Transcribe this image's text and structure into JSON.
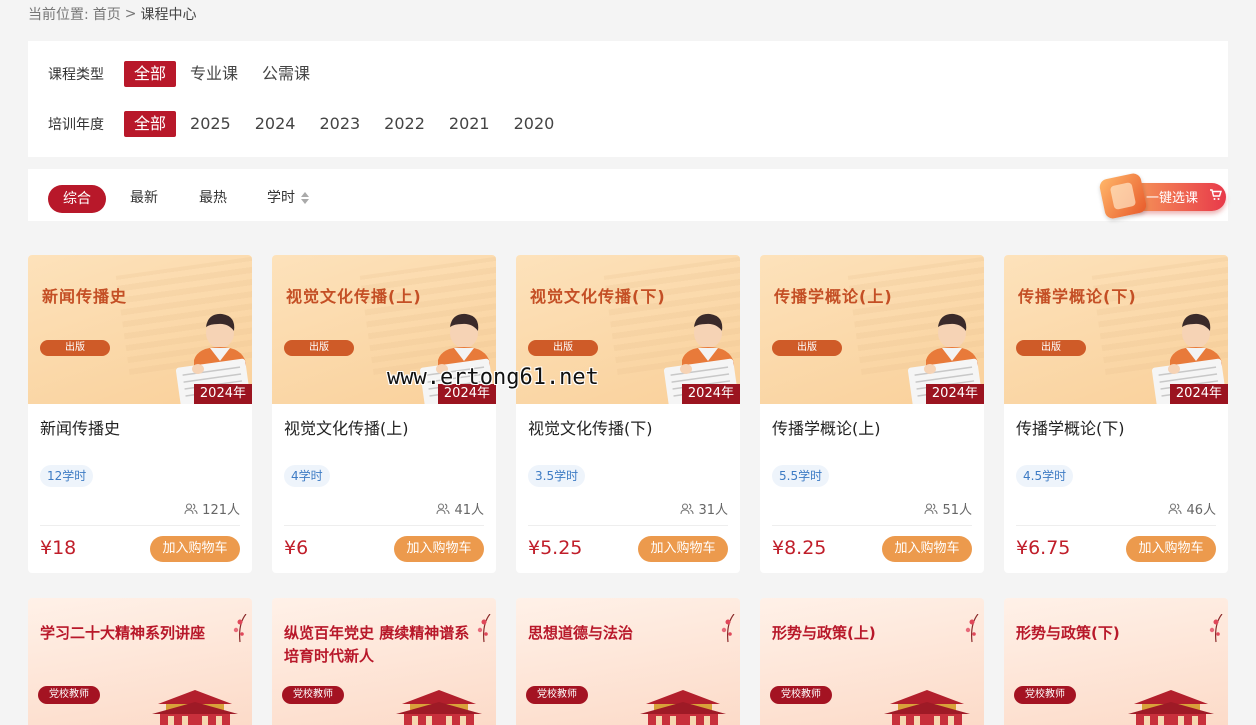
{
  "breadcrumb": {
    "prefix": "当前位置:",
    "home": "首页",
    "sep": ">",
    "current": "课程中心"
  },
  "filters": {
    "type_label": "课程类型",
    "type_options": [
      "全部",
      "专业课",
      "公需课"
    ],
    "year_label": "培训年度",
    "year_options": [
      "全部",
      "2025",
      "2024",
      "2023",
      "2022",
      "2021",
      "2020"
    ]
  },
  "sort": {
    "items": [
      "综合",
      "最新",
      "最热",
      "学时"
    ],
    "active": "综合"
  },
  "one_click": {
    "label": "一键选课"
  },
  "add_label": "加入购物车",
  "courses": [
    {
      "thumb_title": "新闻传播史",
      "tag": "出版",
      "year": "2024年",
      "name": "新闻传播史",
      "hours": "12学时",
      "people": "121人",
      "price": "¥18"
    },
    {
      "thumb_title": "视觉文化传播(上)",
      "tag": "出版",
      "year": "2024年",
      "name": "视觉文化传播(上)",
      "hours": "4学时",
      "people": "41人",
      "price": "¥6"
    },
    {
      "thumb_title": "视觉文化传播(下)",
      "tag": "出版",
      "year": "2024年",
      "name": "视觉文化传播(下)",
      "hours": "3.5学时",
      "people": "31人",
      "price": "¥5.25"
    },
    {
      "thumb_title": "传播学概论(上)",
      "tag": "出版",
      "year": "2024年",
      "name": "传播学概论(上)",
      "hours": "5.5学时",
      "people": "51人",
      "price": "¥8.25"
    },
    {
      "thumb_title": "传播学概论(下)",
      "tag": "出版",
      "year": "2024年",
      "name": "传播学概论(下)",
      "hours": "4.5学时",
      "people": "46人",
      "price": "¥6.75"
    }
  ],
  "courses_row2": [
    {
      "title": "学习二十大精神系列讲座",
      "tag": "党校教师"
    },
    {
      "title": "纵览百年党史 赓续精神谱系 培育时代新人",
      "tag": "党校教师"
    },
    {
      "title": "思想道德与法治",
      "tag": "党校教师"
    },
    {
      "title": "形势与政策(上)",
      "tag": "党校教师"
    },
    {
      "title": "形势与政策(下)",
      "tag": "党校教师"
    }
  ],
  "watermark": "www.ertong61.net",
  "colors": {
    "primary": "#b8182a",
    "button_orange": "#ec9a4d",
    "price_red": "#c01e2a",
    "hours_blue": "#3d7bc4"
  }
}
